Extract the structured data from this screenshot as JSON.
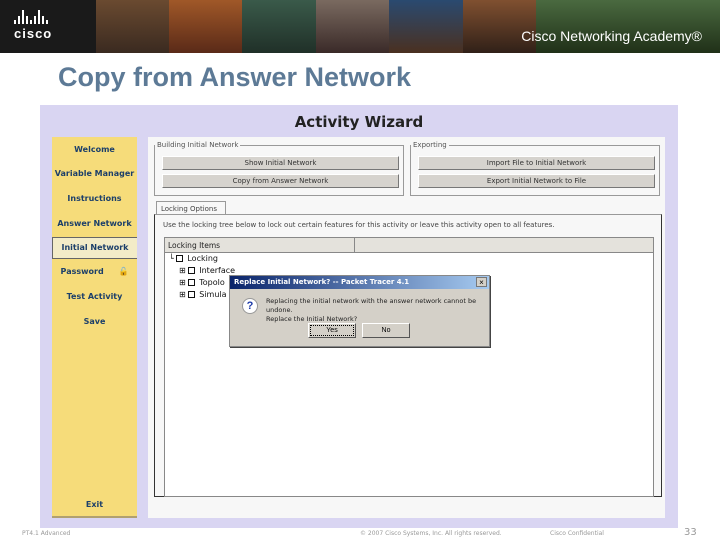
{
  "banner": {
    "logo_text": "cisco",
    "academy": "Cisco Networking Academy®"
  },
  "slide_title": "Copy from Answer Network",
  "wizard": {
    "title": "Activity Wizard",
    "sidebar": [
      "Welcome",
      "Variable Manager",
      "Instructions",
      "Answer Network",
      "Initial Network",
      "Password",
      "Test Activity",
      "Save",
      "Exit"
    ],
    "selected": "Initial Network",
    "building": {
      "legend": "Building Initial Network",
      "buttons": [
        "Show Initial Network",
        "Copy from Answer Network"
      ]
    },
    "exporting": {
      "legend": "Exporting",
      "buttons": [
        "Import File to Initial Network",
        "Export Initial Network to File"
      ]
    },
    "tab": "Locking Options",
    "hint": "Use the locking tree below to lock out certain features for this activity or leave this activity open to all features.",
    "tree_header": "Locking Items",
    "tree": [
      "Locking",
      "Interface",
      "Topolo",
      "Simula"
    ]
  },
  "dialog": {
    "title": "Replace Initial Network? -- Packet Tracer 4.1",
    "message1": "Replacing the initial network with the answer network cannot be undone.",
    "message2": "Replace the Initial Network?",
    "yes": "Yes",
    "no": "No"
  },
  "footer": {
    "left": "PT4.1 Advanced",
    "copyright": "© 2007 Cisco Systems, Inc. All rights reserved.",
    "confidential": "Cisco Confidential",
    "page": "33"
  }
}
